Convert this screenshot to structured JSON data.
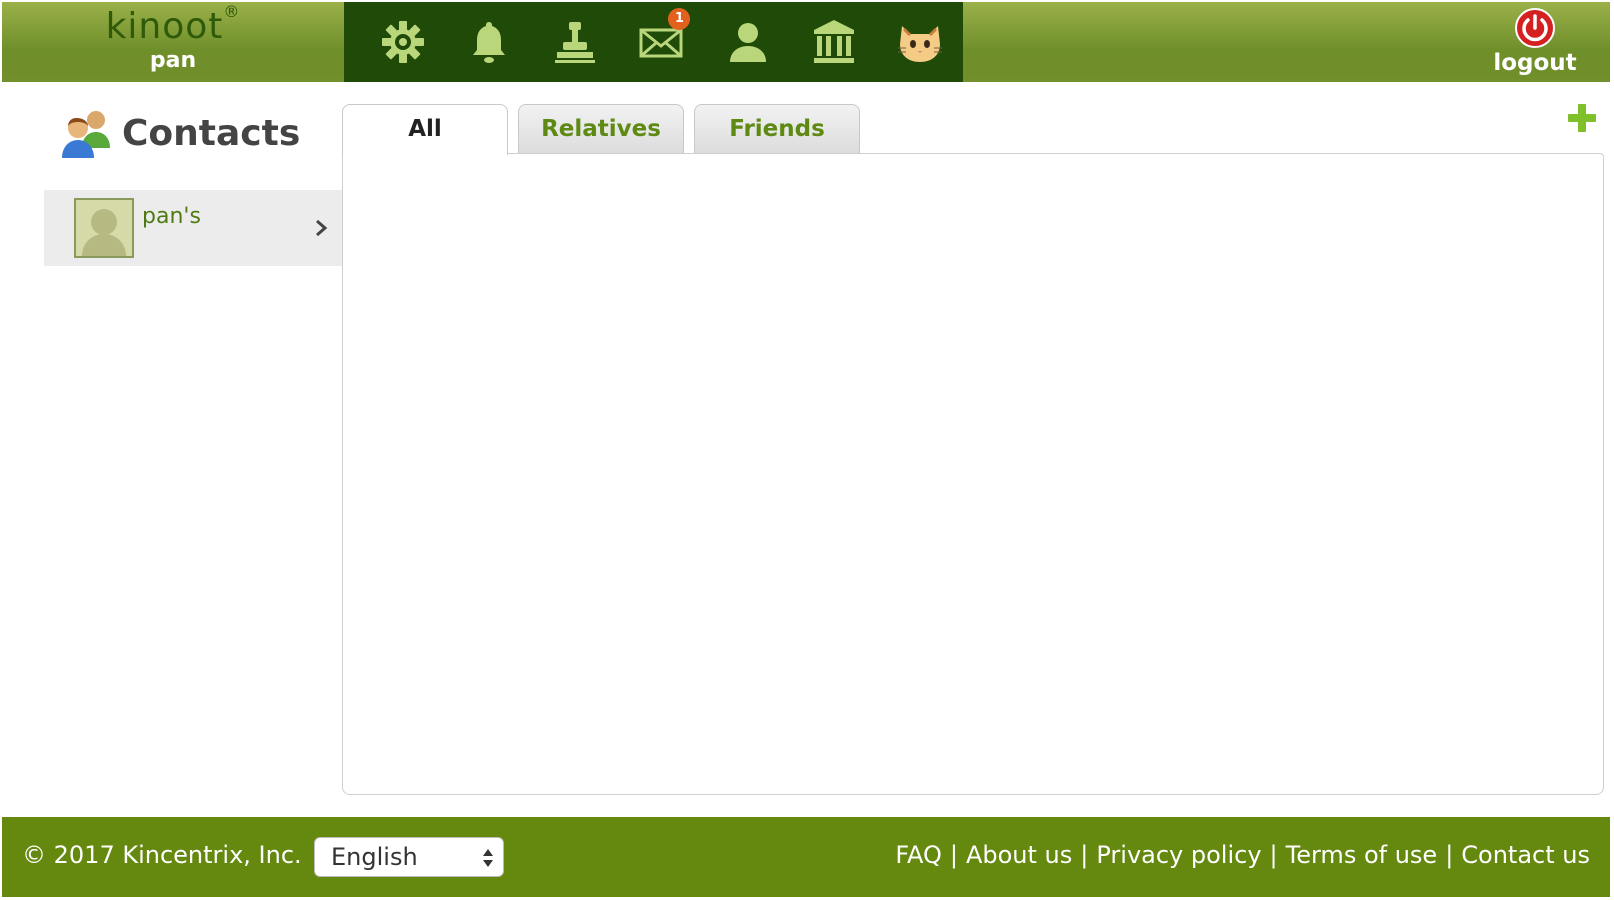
{
  "header": {
    "logo": "kinoot",
    "logo_mark": "®",
    "user": "pan",
    "badge_count": "1",
    "logout_label": "logout",
    "icons": [
      "gear-icon",
      "bell-icon",
      "stamp-icon",
      "mail-icon",
      "person-icon",
      "museum-icon",
      "cat-icon"
    ]
  },
  "sidebar": {
    "title": "Contacts",
    "items": [
      {
        "label": "pan's"
      }
    ]
  },
  "tabs": [
    {
      "label": "All",
      "active": true
    },
    {
      "label": "Relatives",
      "active": false
    },
    {
      "label": "Friends",
      "active": false
    }
  ],
  "footer": {
    "copyright": "© 2017 Kincentrix, Inc.",
    "language": "English",
    "links": [
      "FAQ",
      "About us",
      "Privacy policy",
      "Terms of use",
      "Contact us"
    ]
  },
  "colors": {
    "brand_green": "#65880f",
    "toolbar_dark": "#1f4a08",
    "icon_light": "#b9d67a",
    "badge": "#e2611c",
    "logout_red": "#d42020"
  }
}
